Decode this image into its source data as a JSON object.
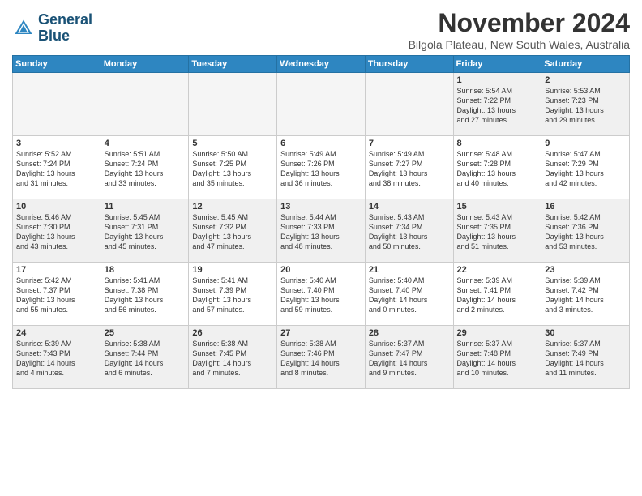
{
  "header": {
    "logo_line1": "General",
    "logo_line2": "Blue",
    "month": "November 2024",
    "location": "Bilgola Plateau, New South Wales, Australia"
  },
  "weekdays": [
    "Sunday",
    "Monday",
    "Tuesday",
    "Wednesday",
    "Thursday",
    "Friday",
    "Saturday"
  ],
  "weeks": [
    [
      {
        "day": "",
        "info": "",
        "empty": true
      },
      {
        "day": "",
        "info": "",
        "empty": true
      },
      {
        "day": "",
        "info": "",
        "empty": true
      },
      {
        "day": "",
        "info": "",
        "empty": true
      },
      {
        "day": "",
        "info": "",
        "empty": true
      },
      {
        "day": "1",
        "info": "Sunrise: 5:54 AM\nSunset: 7:22 PM\nDaylight: 13 hours\nand 27 minutes.",
        "empty": false
      },
      {
        "day": "2",
        "info": "Sunrise: 5:53 AM\nSunset: 7:23 PM\nDaylight: 13 hours\nand 29 minutes.",
        "empty": false
      }
    ],
    [
      {
        "day": "3",
        "info": "Sunrise: 5:52 AM\nSunset: 7:24 PM\nDaylight: 13 hours\nand 31 minutes.",
        "empty": false
      },
      {
        "day": "4",
        "info": "Sunrise: 5:51 AM\nSunset: 7:24 PM\nDaylight: 13 hours\nand 33 minutes.",
        "empty": false
      },
      {
        "day": "5",
        "info": "Sunrise: 5:50 AM\nSunset: 7:25 PM\nDaylight: 13 hours\nand 35 minutes.",
        "empty": false
      },
      {
        "day": "6",
        "info": "Sunrise: 5:49 AM\nSunset: 7:26 PM\nDaylight: 13 hours\nand 36 minutes.",
        "empty": false
      },
      {
        "day": "7",
        "info": "Sunrise: 5:49 AM\nSunset: 7:27 PM\nDaylight: 13 hours\nand 38 minutes.",
        "empty": false
      },
      {
        "day": "8",
        "info": "Sunrise: 5:48 AM\nSunset: 7:28 PM\nDaylight: 13 hours\nand 40 minutes.",
        "empty": false
      },
      {
        "day": "9",
        "info": "Sunrise: 5:47 AM\nSunset: 7:29 PM\nDaylight: 13 hours\nand 42 minutes.",
        "empty": false
      }
    ],
    [
      {
        "day": "10",
        "info": "Sunrise: 5:46 AM\nSunset: 7:30 PM\nDaylight: 13 hours\nand 43 minutes.",
        "empty": false
      },
      {
        "day": "11",
        "info": "Sunrise: 5:45 AM\nSunset: 7:31 PM\nDaylight: 13 hours\nand 45 minutes.",
        "empty": false
      },
      {
        "day": "12",
        "info": "Sunrise: 5:45 AM\nSunset: 7:32 PM\nDaylight: 13 hours\nand 47 minutes.",
        "empty": false
      },
      {
        "day": "13",
        "info": "Sunrise: 5:44 AM\nSunset: 7:33 PM\nDaylight: 13 hours\nand 48 minutes.",
        "empty": false
      },
      {
        "day": "14",
        "info": "Sunrise: 5:43 AM\nSunset: 7:34 PM\nDaylight: 13 hours\nand 50 minutes.",
        "empty": false
      },
      {
        "day": "15",
        "info": "Sunrise: 5:43 AM\nSunset: 7:35 PM\nDaylight: 13 hours\nand 51 minutes.",
        "empty": false
      },
      {
        "day": "16",
        "info": "Sunrise: 5:42 AM\nSunset: 7:36 PM\nDaylight: 13 hours\nand 53 minutes.",
        "empty": false
      }
    ],
    [
      {
        "day": "17",
        "info": "Sunrise: 5:42 AM\nSunset: 7:37 PM\nDaylight: 13 hours\nand 55 minutes.",
        "empty": false
      },
      {
        "day": "18",
        "info": "Sunrise: 5:41 AM\nSunset: 7:38 PM\nDaylight: 13 hours\nand 56 minutes.",
        "empty": false
      },
      {
        "day": "19",
        "info": "Sunrise: 5:41 AM\nSunset: 7:39 PM\nDaylight: 13 hours\nand 57 minutes.",
        "empty": false
      },
      {
        "day": "20",
        "info": "Sunrise: 5:40 AM\nSunset: 7:40 PM\nDaylight: 13 hours\nand 59 minutes.",
        "empty": false
      },
      {
        "day": "21",
        "info": "Sunrise: 5:40 AM\nSunset: 7:40 PM\nDaylight: 14 hours\nand 0 minutes.",
        "empty": false
      },
      {
        "day": "22",
        "info": "Sunrise: 5:39 AM\nSunset: 7:41 PM\nDaylight: 14 hours\nand 2 minutes.",
        "empty": false
      },
      {
        "day": "23",
        "info": "Sunrise: 5:39 AM\nSunset: 7:42 PM\nDaylight: 14 hours\nand 3 minutes.",
        "empty": false
      }
    ],
    [
      {
        "day": "24",
        "info": "Sunrise: 5:39 AM\nSunset: 7:43 PM\nDaylight: 14 hours\nand 4 minutes.",
        "empty": false
      },
      {
        "day": "25",
        "info": "Sunrise: 5:38 AM\nSunset: 7:44 PM\nDaylight: 14 hours\nand 6 minutes.",
        "empty": false
      },
      {
        "day": "26",
        "info": "Sunrise: 5:38 AM\nSunset: 7:45 PM\nDaylight: 14 hours\nand 7 minutes.",
        "empty": false
      },
      {
        "day": "27",
        "info": "Sunrise: 5:38 AM\nSunset: 7:46 PM\nDaylight: 14 hours\nand 8 minutes.",
        "empty": false
      },
      {
        "day": "28",
        "info": "Sunrise: 5:37 AM\nSunset: 7:47 PM\nDaylight: 14 hours\nand 9 minutes.",
        "empty": false
      },
      {
        "day": "29",
        "info": "Sunrise: 5:37 AM\nSunset: 7:48 PM\nDaylight: 14 hours\nand 10 minutes.",
        "empty": false
      },
      {
        "day": "30",
        "info": "Sunrise: 5:37 AM\nSunset: 7:49 PM\nDaylight: 14 hours\nand 11 minutes.",
        "empty": false
      }
    ]
  ]
}
